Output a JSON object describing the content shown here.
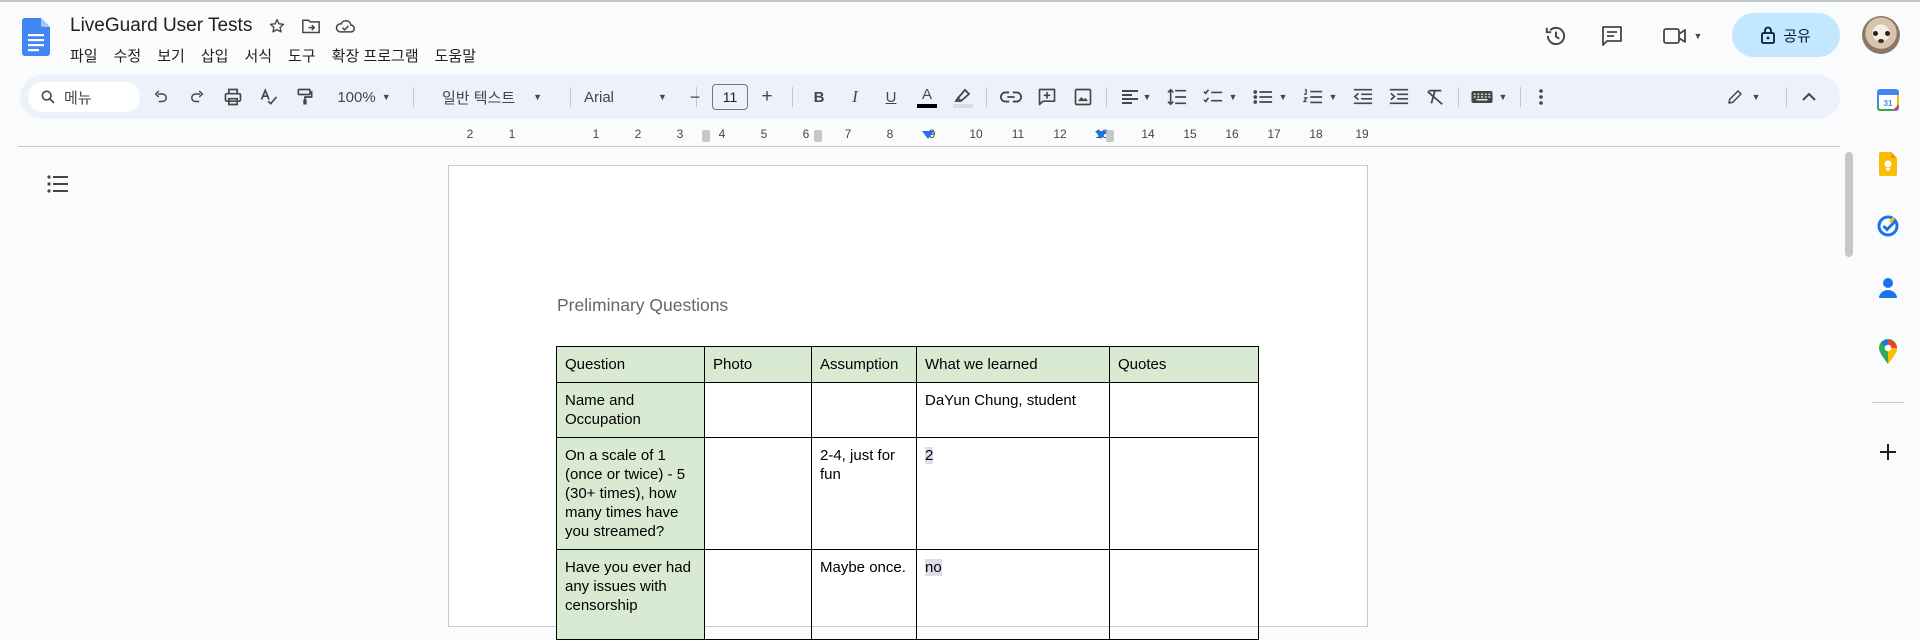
{
  "document": {
    "title": "LiveGuard User Tests"
  },
  "menu": [
    "파일",
    "수정",
    "보기",
    "삽입",
    "서식",
    "도구",
    "확장 프로그램",
    "도움말"
  ],
  "header": {
    "share_label": "공유"
  },
  "toolbar": {
    "search_placeholder": "메뉴",
    "zoom": "100%",
    "style": "일반 텍스트",
    "font": "Arial",
    "font_size": "11",
    "decrease": "−",
    "increase": "+",
    "bold": "B",
    "italic": "I",
    "underline": "U",
    "text_color_letter": "A"
  },
  "ruler": {
    "labels": [
      "2",
      "1",
      "1",
      "2",
      "3",
      "4",
      "5",
      "6",
      "7",
      "8",
      "9",
      "10",
      "11",
      "12",
      "13",
      "14",
      "15",
      "16",
      "17",
      "18",
      "19"
    ]
  },
  "page": {
    "heading": "Preliminary Questions",
    "table": {
      "headers": [
        "Question",
        "Photo",
        "Assumption",
        "What we learned",
        "Quotes"
      ],
      "rows": [
        [
          "Name and Occupation",
          "",
          "",
          "DaYun Chung, student",
          ""
        ],
        [
          "On a scale of 1 (once or twice) - 5 (30+ times), how many times have you streamed?",
          "",
          "2-4, just for fun",
          "2",
          ""
        ],
        [
          "Have you ever had any issues with censorship",
          "",
          "Maybe once.",
          "no",
          ""
        ]
      ]
    }
  },
  "colors": {
    "accent": "#1a73e8",
    "share_bg": "#c2e7ff",
    "header_cell_bg": "#d9ead3",
    "toolbar_bg": "#edf2fa"
  },
  "icons": {
    "header": [
      "star-icon",
      "move-folder-icon",
      "cloud-saved-icon",
      "history-icon",
      "comment-icon",
      "video-call-icon",
      "lock-icon"
    ],
    "side_panel": [
      "calendar-icon",
      "keep-icon",
      "tasks-icon",
      "contacts-icon",
      "maps-icon",
      "add-icon"
    ]
  }
}
